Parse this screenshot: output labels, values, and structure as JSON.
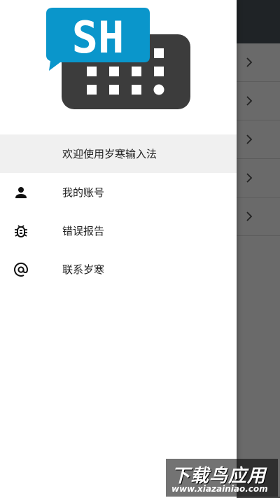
{
  "logo": {
    "text": "SH",
    "accent_color": "#0a96cb",
    "keyboard_color": "#3c3c3c"
  },
  "menu": {
    "items": [
      {
        "label": "欢迎使用岁寒输入法",
        "icon": "none",
        "selected": true
      },
      {
        "label": "我的账号",
        "icon": "person-icon",
        "selected": false
      },
      {
        "label": "错误报告",
        "icon": "bug-icon",
        "selected": false
      },
      {
        "label": "联系岁寒",
        "icon": "at-sign-icon",
        "selected": false
      }
    ]
  },
  "background": {
    "list_rows": 5,
    "topbar_color": "#1f2326"
  },
  "watermark": {
    "title": "下载鸟应用",
    "url": "www.xiazainiao.com"
  }
}
